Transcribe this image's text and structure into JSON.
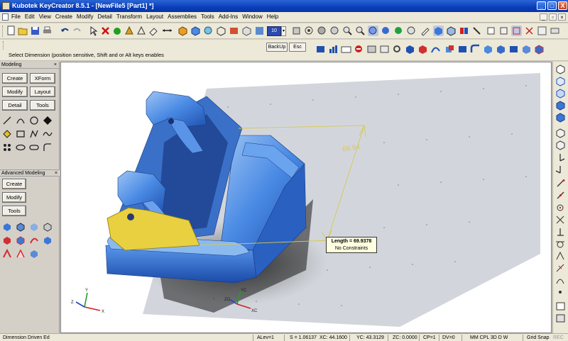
{
  "window": {
    "title": "Kubotek KeyCreator 8.5.1 - [NewFile5 [Part1] *]",
    "buttons": [
      "_",
      "□",
      "X"
    ]
  },
  "menu": {
    "items": [
      "File",
      "Edit",
      "View",
      "Create",
      "Modify",
      "Detail",
      "Transform",
      "Layout",
      "Assemblies",
      "Tools",
      "Add-Ins",
      "Window",
      "Help"
    ]
  },
  "toolbar": {
    "zoom_value": "10",
    "backup_label": "BackUp",
    "esc_label": "Esc"
  },
  "prompt": {
    "text": "Select Dimension  (position sensitive,  Shift and or Alt keys enables"
  },
  "left_panel": {
    "modeling_title": "Modeling",
    "modeling_buttons": [
      "Create",
      "XForm",
      "Modify",
      "Layout",
      "Detail",
      "Tools"
    ],
    "advanced_title": "Advanced Modeling",
    "advanced_buttons": [
      "Create",
      "Modify",
      "Tools"
    ]
  },
  "viewport": {
    "dimension_value": "69.94",
    "tooltip_line1": "Length = 69.9378",
    "tooltip_line2": "No Constraints",
    "axis_x": "X",
    "axis_y": "Y",
    "axis_z": "Z",
    "axis_xc": "XC",
    "axis_yc": "YC",
    "axis_zc": "ZC"
  },
  "status": {
    "mode": "Dimension Driven Ed",
    "alev": "ALev=1",
    "scale": "S = 1.06137",
    "xc": "XC: 44.1600",
    "yc": "YC: 43.3129",
    "zc": "ZC: 0.0000",
    "cp": "CP=1",
    "dv": "DV=0",
    "flags": "MM  CPL  3D  D  W",
    "grid": "Grid Snap",
    "rec": "REC"
  },
  "colors": {
    "titlebar": "#0a3eb8",
    "part_blue": "#3a78d8",
    "dimension_yellow": "#e8d040",
    "viewport_bg": "#ffffff"
  }
}
